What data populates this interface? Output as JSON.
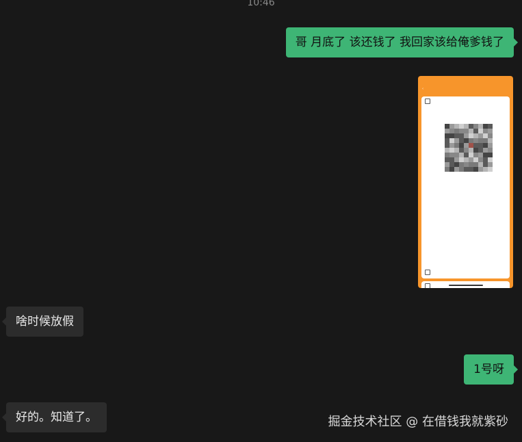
{
  "header": {
    "time": "10:46"
  },
  "messages": [
    {
      "side": "me",
      "text": "哥   月底了  该还钱了   我回家该给俺爹钱了"
    },
    {
      "side": "me",
      "type": "image",
      "alt": ""
    },
    {
      "side": "other",
      "text": "啥时候放假"
    },
    {
      "side": "me",
      "text": "1号呀"
    },
    {
      "side": "other",
      "text": "好的。知道了。"
    }
  ],
  "watermark": "掘金技术社区 @ 在借钱我就紫砂",
  "colors": {
    "background": "#181818",
    "my_bubble": "#3eb575",
    "other_bubble": "#2c2c2c",
    "screenshot_accent": "#f7952b"
  }
}
